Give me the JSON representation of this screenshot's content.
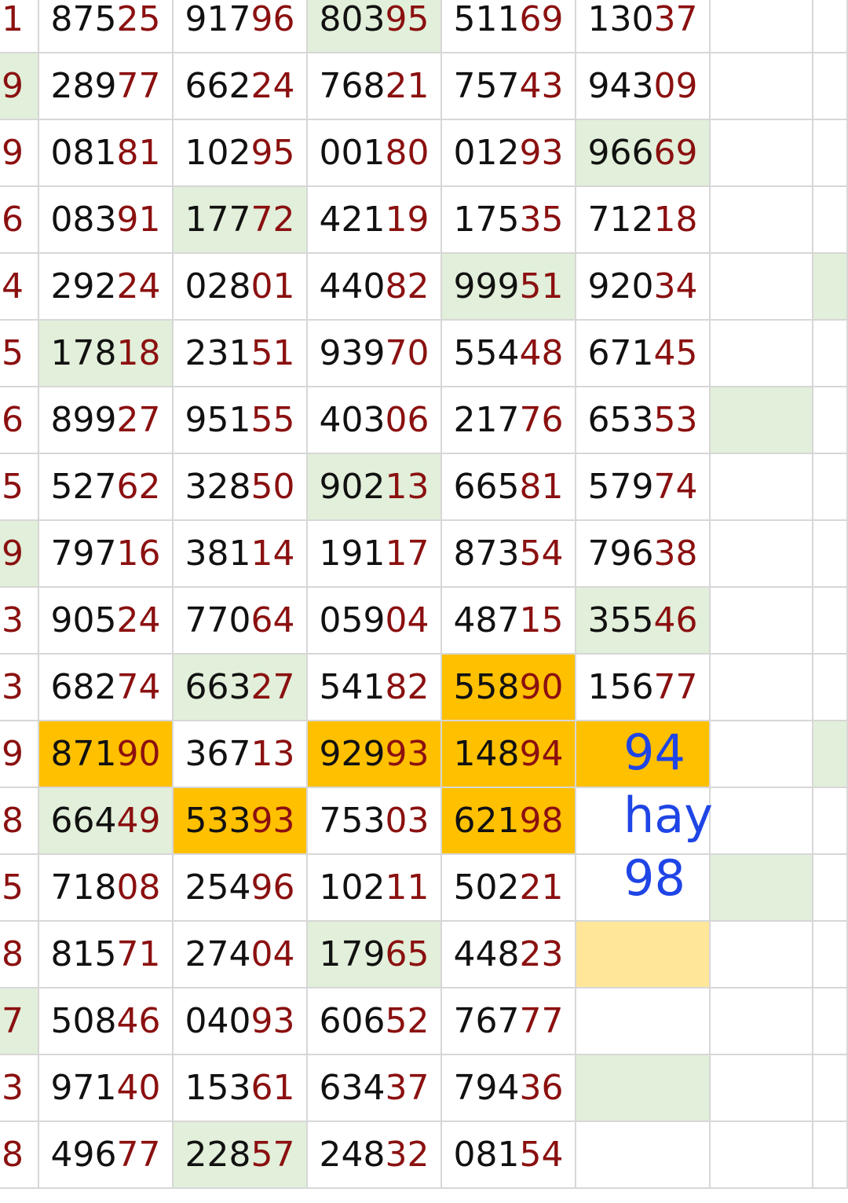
{
  "sheet": {
    "rows": [
      {
        "left": "1",
        "values": [
          "87525",
          "91796",
          "80395",
          "51169",
          "13037"
        ]
      },
      {
        "left": "9",
        "values": [
          "28977",
          "66224",
          "76821",
          "75743",
          "94309"
        ]
      },
      {
        "left": "9",
        "values": [
          "08181",
          "10295",
          "00180",
          "01293",
          "96669"
        ]
      },
      {
        "left": "6",
        "values": [
          "08391",
          "17772",
          "42119",
          "17535",
          "71218"
        ]
      },
      {
        "left": "4",
        "values": [
          "29224",
          "02801",
          "44082",
          "99951",
          "92034"
        ]
      },
      {
        "left": "5",
        "values": [
          "17818",
          "23151",
          "93970",
          "55448",
          "67145"
        ]
      },
      {
        "left": "6",
        "values": [
          "89927",
          "95155",
          "40306",
          "21776",
          "65353"
        ]
      },
      {
        "left": "5",
        "values": [
          "52762",
          "32850",
          "90213",
          "66581",
          "57974"
        ]
      },
      {
        "left": "9",
        "values": [
          "79716",
          "38114",
          "19117",
          "87354",
          "79638"
        ]
      },
      {
        "left": "3",
        "values": [
          "90524",
          "77064",
          "05904",
          "48715",
          "35546"
        ]
      },
      {
        "left": "3",
        "values": [
          "68274",
          "66327",
          "54182",
          "55890",
          "15677"
        ]
      },
      {
        "left": "9",
        "values": [
          "87190",
          "36713",
          "92993",
          "14894",
          ""
        ]
      },
      {
        "left": "8",
        "values": [
          "66449",
          "53393",
          "75303",
          "62198",
          ""
        ]
      },
      {
        "left": "5",
        "values": [
          "71808",
          "25496",
          "10211",
          "50221",
          ""
        ]
      },
      {
        "left": "8",
        "values": [
          "81571",
          "27404",
          "17965",
          "44823",
          ""
        ]
      },
      {
        "left": "7",
        "values": [
          "50846",
          "04093",
          "60652",
          "76777",
          ""
        ]
      },
      {
        "left": "3",
        "values": [
          "97140",
          "15361",
          "63437",
          "79436",
          ""
        ]
      },
      {
        "left": "8",
        "values": [
          "49677",
          "22857",
          "24832",
          "08154",
          ""
        ]
      }
    ],
    "highlights": {
      "green_cells": [
        [
          0,
          3
        ],
        [
          1,
          0
        ],
        [
          2,
          5
        ],
        [
          3,
          2
        ],
        [
          4,
          4
        ],
        [
          4,
          7
        ],
        [
          5,
          1
        ],
        [
          6,
          6
        ],
        [
          7,
          3
        ],
        [
          8,
          0
        ],
        [
          9,
          5
        ],
        [
          10,
          2
        ],
        [
          11,
          7
        ],
        [
          12,
          1
        ],
        [
          13,
          6
        ],
        [
          14,
          3
        ],
        [
          15,
          0
        ],
        [
          16,
          5
        ],
        [
          17,
          2
        ]
      ],
      "orange_cells": [
        [
          10,
          4
        ],
        [
          11,
          1
        ],
        [
          11,
          3
        ],
        [
          11,
          4
        ],
        [
          11,
          5
        ],
        [
          12,
          2
        ],
        [
          12,
          4
        ]
      ],
      "light_orange_cells": [
        [
          14,
          5
        ]
      ],
      "colors": {
        "green": "#e2efda",
        "orange": "#ffc000",
        "light_orange": "#ffe699",
        "text_dark": "#111111",
        "text_red": "#8b1010",
        "note_blue": "#1f45e6",
        "grid": "#d7d7d7"
      }
    },
    "note": [
      "94",
      "hay",
      "98"
    ]
  }
}
